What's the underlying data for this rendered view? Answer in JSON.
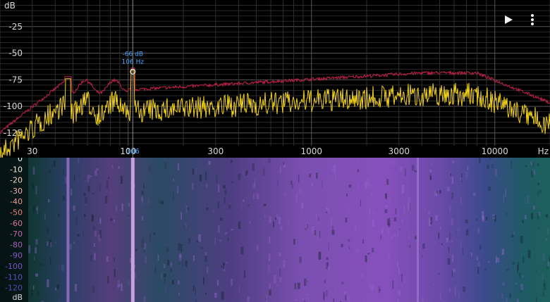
{
  "spectrum": {
    "y_unit": "dB",
    "x_unit": "Hz",
    "y_ticks": [
      {
        "label": "-25",
        "value": -25
      },
      {
        "label": "-50",
        "value": -50
      },
      {
        "label": "-75",
        "value": -75
      },
      {
        "label": "-100",
        "value": -100
      },
      {
        "label": "-125",
        "value": -125
      }
    ],
    "x_ticks": [
      {
        "label": "30",
        "value": 30
      },
      {
        "label": "100",
        "value": 100
      },
      {
        "label": "300",
        "value": 300
      },
      {
        "label": "1000",
        "value": 1000
      },
      {
        "label": "3000",
        "value": 3000
      },
      {
        "label": "10000",
        "value": 10000
      }
    ],
    "y_range": [
      -137,
      0
    ],
    "x_range": [
      20,
      20000
    ],
    "x_scale": "log",
    "cursor": {
      "db_label": "-66 dB",
      "hz_label": "106 Hz",
      "axis_label": "106",
      "freq": 106,
      "db": -66
    },
    "colors": {
      "live": "#f2d21b",
      "peak": "#c8204a",
      "cursor": "#4aa8ff",
      "grid": "#3a3a3a",
      "text": "#d8d8d8"
    }
  },
  "spectrogram": {
    "y_unit": "dB",
    "scale": [
      {
        "label": "0",
        "color": "#ffffff"
      },
      {
        "label": "-10",
        "color": "#fde9d8"
      },
      {
        "label": "-20",
        "color": "#f8cfc0"
      },
      {
        "label": "-30",
        "color": "#f3b3a8"
      },
      {
        "label": "-40",
        "color": "#ee9890"
      },
      {
        "label": "-50",
        "color": "#e8807a"
      },
      {
        "label": "-60",
        "color": "#dc7390"
      },
      {
        "label": "-70",
        "color": "#c46aa8"
      },
      {
        "label": "-80",
        "color": "#a860b8"
      },
      {
        "label": "-90",
        "color": "#8e5ac4"
      },
      {
        "label": "-100",
        "color": "#7655c6"
      },
      {
        "label": "-110",
        "color": "#6052c0"
      },
      {
        "label": "-120",
        "color": "#4c4eb4"
      }
    ]
  },
  "toolbar": {
    "play_icon": "play-icon",
    "menu_icon": "more-vert-icon"
  }
}
